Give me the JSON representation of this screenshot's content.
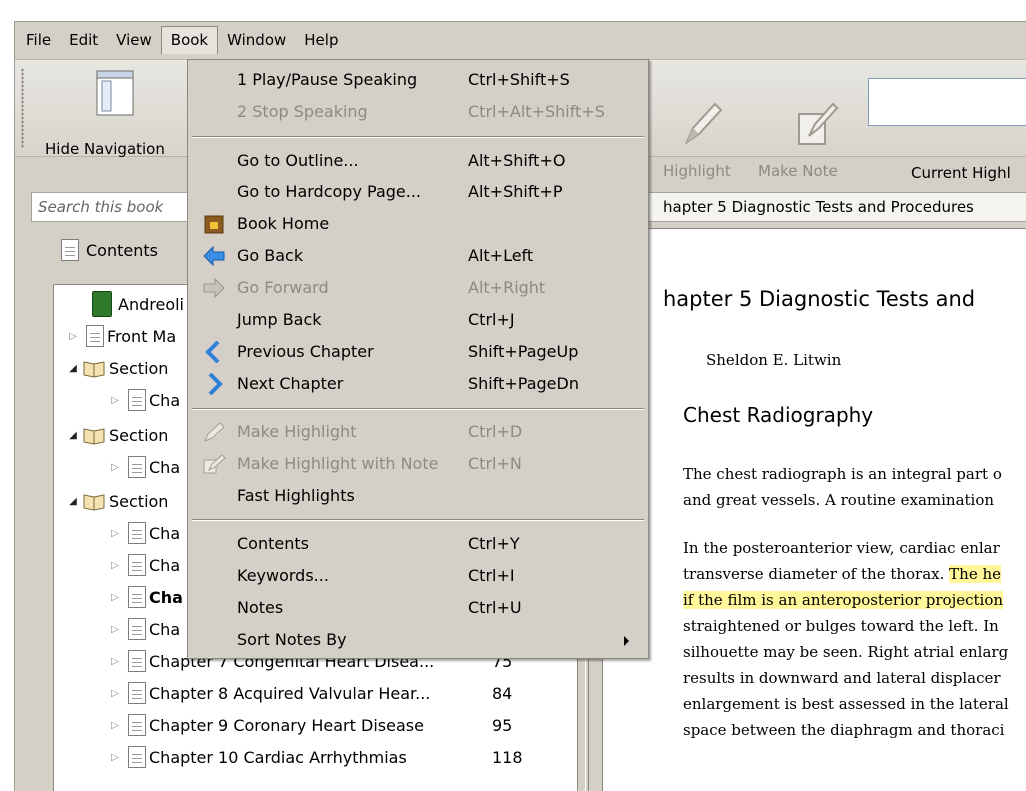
{
  "menubar": [
    "File",
    "Edit",
    "View",
    "Book",
    "Window",
    "Help"
  ],
  "toolbar": {
    "hide_navigation": "Hide Navigation",
    "highlight": "Highlight",
    "make_note": "Make Note",
    "current_highlight": "Current Highl"
  },
  "left": {
    "search_placeholder": "Search this book",
    "contents_tab": "Contents",
    "tree": [
      {
        "label": "Andreoli",
        "num": ""
      },
      {
        "label": "Front Ma",
        "num": ""
      },
      {
        "label": "Section",
        "num": ""
      },
      {
        "label": "Cha",
        "num": ""
      },
      {
        "label": "Section",
        "num": ""
      },
      {
        "label": "Cha",
        "num": ""
      },
      {
        "label": "Section",
        "num": ""
      },
      {
        "label": "Cha",
        "num": ""
      },
      {
        "label": "Cha",
        "num": ""
      },
      {
        "label": "Cha",
        "num": ""
      },
      {
        "label": "Cha",
        "num": ""
      },
      {
        "label": "Chapter 7 Congenital Heart Disea...",
        "num": "75"
      },
      {
        "label": "Chapter 8 Acquired Valvular Hear...",
        "num": "84"
      },
      {
        "label": "Chapter 9 Coronary Heart Disease",
        "num": "95"
      },
      {
        "label": "Chapter 10 Cardiac Arrhythmias",
        "num": "118"
      }
    ]
  },
  "content": {
    "tab": "hapter 5 Diagnostic Tests and Procedures",
    "chapter_title": "hapter 5  Diagnostic Tests and",
    "author": "Sheldon E. Litwin",
    "section_heading": "Chest Radiography",
    "para1": [
      "The chest radiograph is an integral part o",
      "and great vessels. A routine examination"
    ],
    "para2_l1": "In the posteroanterior view, cardiac enlar",
    "para2_l2a": "transverse diameter of the thorax. ",
    "para2_l2b": "The he",
    "para2_l3": "if the film is an anteroposterior projection",
    "para2_rest": [
      "straightened or bulges toward the left. In",
      "silhouette may be seen. Right atrial enlarg",
      "results in downward and lateral displacer",
      "enlargement is best assessed in the lateral",
      "space between the diaphragm and thoraci"
    ]
  },
  "book_menu": [
    {
      "label": "1 Play/Pause Speaking",
      "shortcut": "Ctrl+Shift+S",
      "disabled": false,
      "icon": ""
    },
    {
      "label": "2 Stop Speaking",
      "shortcut": "Ctrl+Alt+Shift+S",
      "disabled": true,
      "icon": ""
    },
    {
      "label": "Go to Outline...",
      "shortcut": "Alt+Shift+O",
      "disabled": false,
      "icon": ""
    },
    {
      "label": "Go to Hardcopy Page...",
      "shortcut": "Alt+Shift+P",
      "disabled": false,
      "icon": ""
    },
    {
      "label": "Book Home",
      "shortcut": "",
      "disabled": false,
      "icon": "home-icon"
    },
    {
      "label": "Go Back",
      "shortcut": "Alt+Left",
      "disabled": false,
      "icon": "back-arrow-icon"
    },
    {
      "label": "Go Forward",
      "shortcut": "Alt+Right",
      "disabled": true,
      "icon": "forward-arrow-icon"
    },
    {
      "label": "Jump Back",
      "shortcut": "Ctrl+J",
      "disabled": false,
      "icon": ""
    },
    {
      "label": "Previous Chapter",
      "shortcut": "Shift+PageUp",
      "disabled": false,
      "icon": "previous-chevron-icon"
    },
    {
      "label": "Next Chapter",
      "shortcut": "Shift+PageDn",
      "disabled": false,
      "icon": "next-chevron-icon"
    },
    {
      "label": "Make Highlight",
      "shortcut": "Ctrl+D",
      "disabled": true,
      "icon": "pen-icon"
    },
    {
      "label": "Make Highlight with Note",
      "shortcut": "Ctrl+N",
      "disabled": true,
      "icon": "pen-note-icon"
    },
    {
      "label": "Fast Highlights",
      "shortcut": "",
      "disabled": false,
      "icon": ""
    },
    {
      "label": "Contents",
      "shortcut": "Ctrl+Y",
      "disabled": false,
      "icon": ""
    },
    {
      "label": "Keywords...",
      "shortcut": "Ctrl+I",
      "disabled": false,
      "icon": ""
    },
    {
      "label": "Notes",
      "shortcut": "Ctrl+U",
      "disabled": false,
      "icon": ""
    },
    {
      "label": "Sort Notes By",
      "shortcut": "",
      "disabled": false,
      "icon": "submenu-arrow-icon"
    }
  ],
  "colors": {
    "highlight": "#fff79a",
    "chrome": "#d4d0c8",
    "arrow_blue": "#2f7fd8"
  }
}
